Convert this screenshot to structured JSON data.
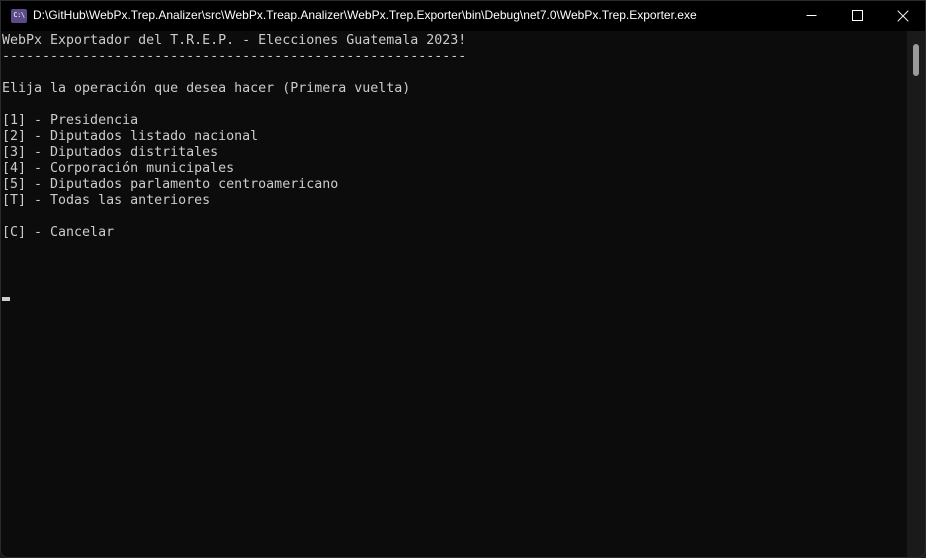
{
  "window": {
    "title": "D:\\GitHub\\WebPx.Trep.Analizer\\src\\WebPx.Treap.Analizer\\WebPx.Trep.Exporter\\bin\\Debug\\net7.0\\WebPx.Trep.Exporter.exe",
    "icon": "console-icon",
    "icon_glyph": "C:\\",
    "colors": {
      "titlebar_background": "#000000",
      "titlebar_text": "#ffffff",
      "console_background": "#0c0c0c",
      "console_text": "#cccccc",
      "scrollbar_track": "#1a1a1a",
      "scrollbar_thumb": "#9a9a9a",
      "icon_background": "#5c4a8a"
    },
    "controls": [
      {
        "name": "minimize",
        "label": "—"
      },
      {
        "name": "maximize",
        "label": "□"
      },
      {
        "name": "close",
        "label": "✕"
      }
    ]
  },
  "console": {
    "banner": "WebPx Exportador del T.R.E.P. - Elecciones Guatemala 2023!",
    "separator": "----------------------------------------------------------",
    "prompt": "Elija la operación que desea hacer (Primera vuelta)",
    "options": [
      "[1] - Presidencia",
      "[2] - Diputados listado nacional",
      "[3] - Diputados distritales",
      "[4] - Corporación municipales",
      "[5] - Diputados parlamento centroamericano",
      "[T] - Todas las anteriores"
    ],
    "cancel_option": "[C] - Cancelar",
    "screen_text": "WebPx Exportador del T.R.E.P. - Elecciones Guatemala 2023!\n----------------------------------------------------------\n\nElija la operación que desea hacer (Primera vuelta)\n\n[1] - Presidencia\n[2] - Diputados listado nacional\n[3] - Diputados distritales\n[4] - Corporación municipales\n[5] - Diputados parlamento centroamericano\n[T] - Todas las anteriores\n\n[C] - Cancelar"
  }
}
